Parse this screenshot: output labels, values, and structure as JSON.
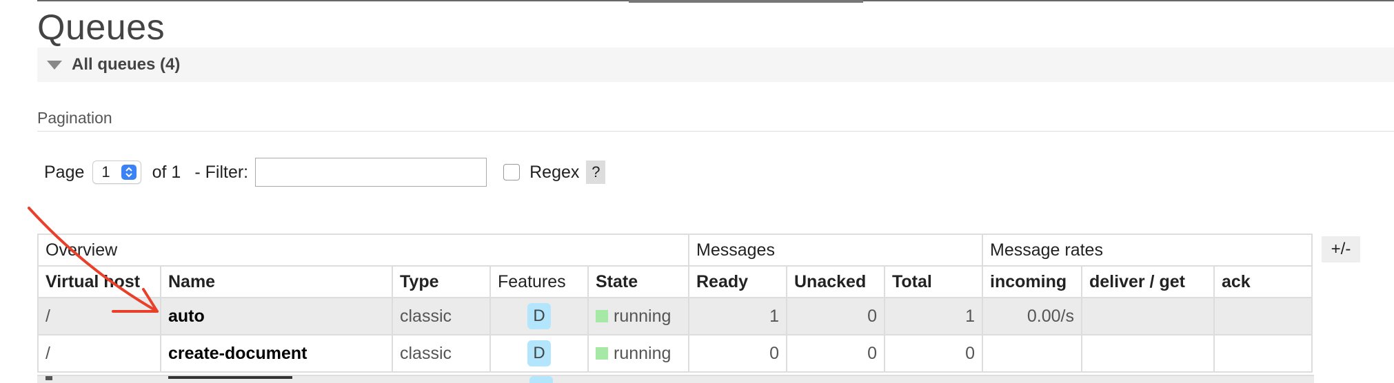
{
  "header": {
    "title": "Queues"
  },
  "section": {
    "title": "All queues (4)"
  },
  "pagination": {
    "label": "Pagination",
    "page_label": "Page",
    "page_value": "1",
    "of_label": "of 1",
    "filter_label": "- Filter:",
    "filter_value": "",
    "regex_label": "Regex",
    "help_label": "?"
  },
  "table": {
    "groups": [
      "Overview",
      "Messages",
      "Message rates"
    ],
    "columns": [
      "Virtual host",
      "Name",
      "Type",
      "Features",
      "State",
      "Ready",
      "Unacked",
      "Total",
      "incoming",
      "deliver / get",
      "ack"
    ],
    "rows": [
      {
        "vhost": "/",
        "name": "auto",
        "type": "classic",
        "feature": "D",
        "state": "running",
        "ready": "1",
        "unacked": "0",
        "total": "1",
        "incoming": "0.00/s",
        "deliver_get": "",
        "ack": ""
      },
      {
        "vhost": "/",
        "name": "create-document",
        "type": "classic",
        "feature": "D",
        "state": "running",
        "ready": "0",
        "unacked": "0",
        "total": "0",
        "incoming": "",
        "deliver_get": "",
        "ack": ""
      }
    ],
    "toggle_columns_label": "+/-"
  },
  "icons": {
    "collapse": "triangle-down-icon",
    "select": "updown-chevron-icon",
    "annotation": "red-arrow"
  },
  "colors": {
    "arrow": "#e8402a",
    "running": "#a6e8a6",
    "feature_badge": "#b3e5fc",
    "select_chevron": "#3b82f6"
  }
}
